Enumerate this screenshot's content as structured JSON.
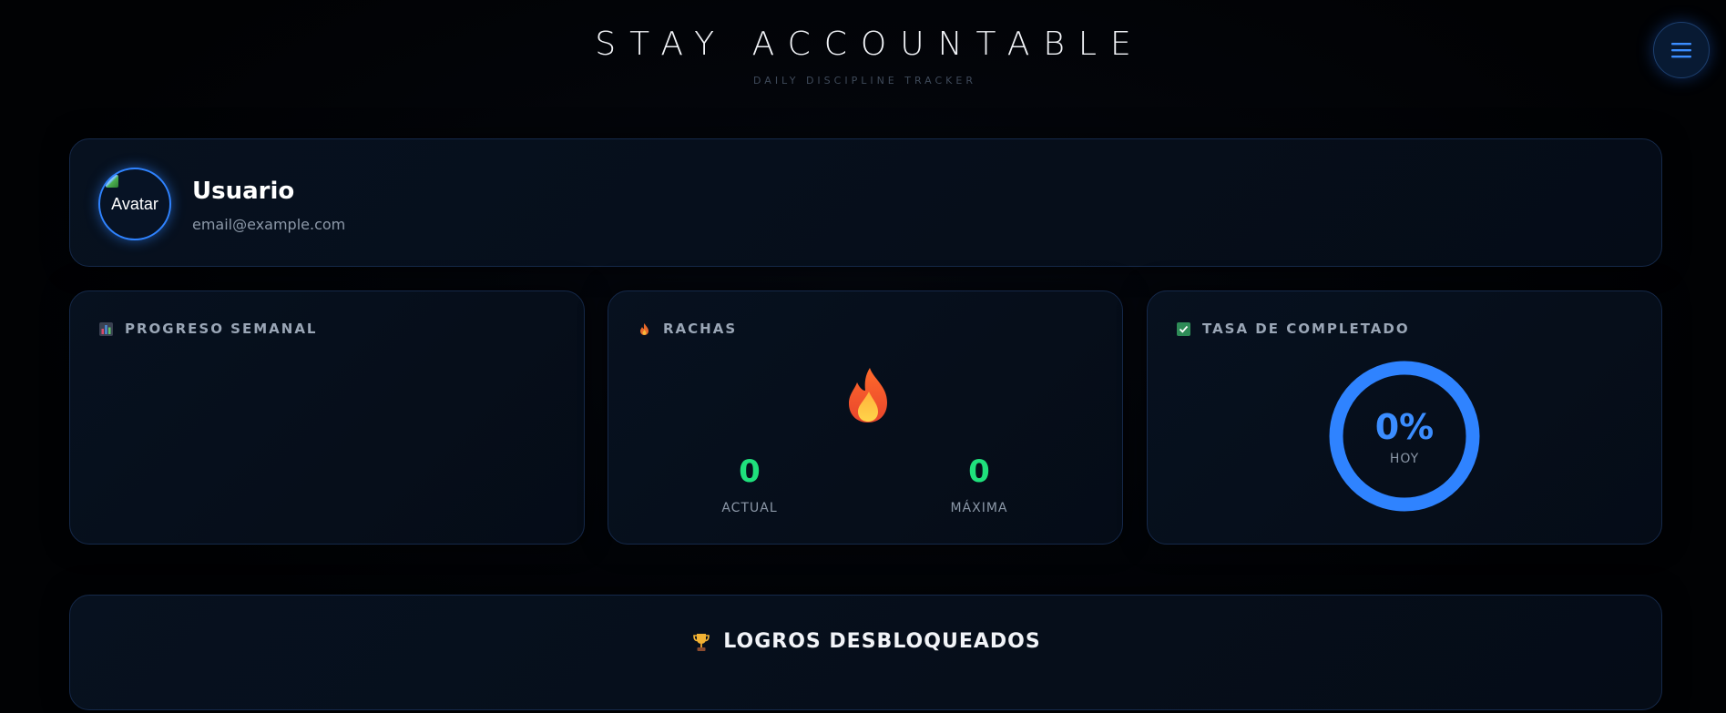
{
  "header": {
    "title": "STAY ACCOUNTABLE",
    "subtitle": "DAILY DISCIPLINE TRACKER",
    "menu_icon": "hamburger-menu-icon"
  },
  "profile": {
    "avatar_alt": "Avatar",
    "name": "Usuario",
    "email": "email@example.com"
  },
  "weekly_progress": {
    "title": "PROGRESO SEMANAL",
    "icon": "bar-chart-icon"
  },
  "streaks": {
    "title": "RACHAS",
    "icon": "fire-icon",
    "current_value": "0",
    "current_label": "ACTUAL",
    "max_value": "0",
    "max_label": "MÁXIMA"
  },
  "completion_rate": {
    "title": "TASA DE COMPLETADO",
    "icon": "check-box-icon",
    "value": "0%",
    "label": "HOY",
    "accent_color": "#2f83ff"
  },
  "achievements": {
    "title": "LOGROS DESBLOQUEADOS",
    "icon": "trophy-icon"
  },
  "colors": {
    "background": "#020408",
    "card": "#07111f",
    "accent": "#2f83ff",
    "streak_green": "#1fe07c"
  }
}
